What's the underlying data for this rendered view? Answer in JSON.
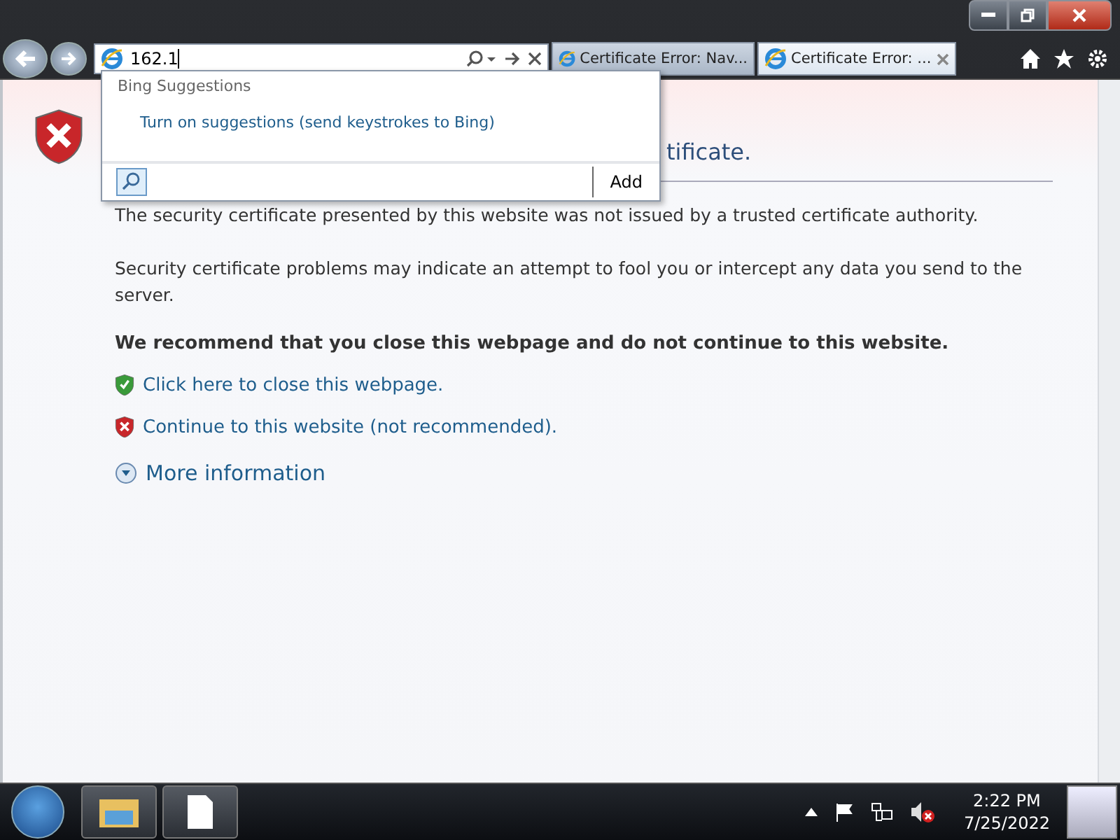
{
  "address_bar": {
    "value": "162.1"
  },
  "tabs": [
    {
      "label": "Certificate Error: Nav...",
      "selected": false
    },
    {
      "label": "Certificate Error: ...",
      "selected": true
    }
  ],
  "suggestions": {
    "heading": "Bing Suggestions",
    "link": "Turn on suggestions (send keystrokes to Bing)",
    "add_button": "Add"
  },
  "page": {
    "headline": "tificate.",
    "paragraphs": [
      "The security certificate presented by this website was not issued by a trusted certificate authority.",
      "Security certificate problems may indicate an attempt to fool you or intercept any data you send to the server."
    ],
    "recommendation": "We recommend that you close this webpage and do not continue to this website.",
    "links": [
      {
        "kind": "safe",
        "label": "Click here to close this webpage."
      },
      {
        "kind": "unsafe",
        "label": "Continue to this website (not recommended)."
      }
    ],
    "more_info": "More information"
  },
  "taskbar": {
    "time": "2:22 PM",
    "date": "7/25/2022"
  }
}
